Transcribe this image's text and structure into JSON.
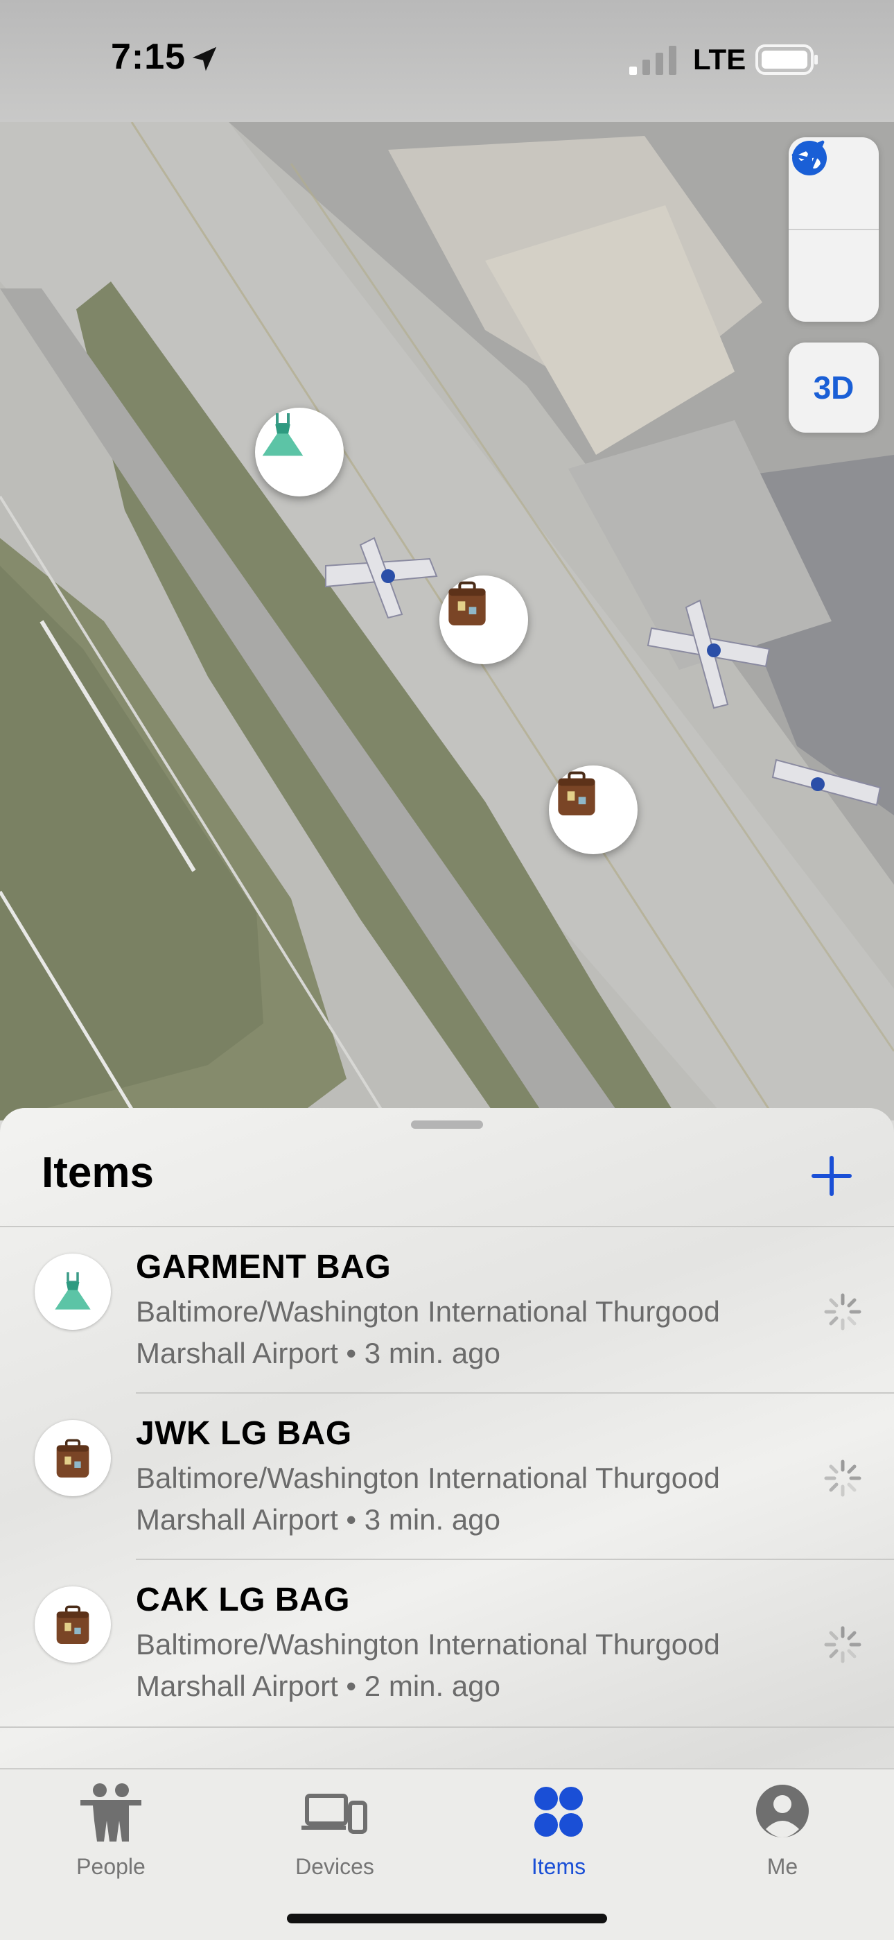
{
  "status_bar": {
    "time": "7:15",
    "network": "LTE",
    "icons": [
      "location-arrow-icon",
      "cellular-signal-icon",
      "battery-icon"
    ]
  },
  "map": {
    "controls": {
      "globe_icon": "globe-icon",
      "location_icon": "location-arrow-icon",
      "mode_3d_label": "3D"
    },
    "pins": [
      {
        "name": "GARMENT BAG",
        "emoji": "👗"
      },
      {
        "name": "JWK LG BAG",
        "emoji": "🧳"
      },
      {
        "name": "CAK LG BAG",
        "emoji": "🧳"
      }
    ]
  },
  "sheet": {
    "title": "Items",
    "add_icon": "plus-icon",
    "items": [
      {
        "name": "GARMENT BAG",
        "emoji": "👗",
        "location_line1": "Baltimore/Washington International Thurgood",
        "location_line2": "Marshall Airport • 3 min. ago"
      },
      {
        "name": "JWK LG BAG",
        "emoji": "🧳",
        "location_line1": "Baltimore/Washington International Thurgood",
        "location_line2": "Marshall Airport • 3 min. ago"
      },
      {
        "name": "CAK LG BAG",
        "emoji": "🧳",
        "location_line1": "Baltimore/Washington International Thurgood",
        "location_line2": "Marshall Airport • 2 min. ago"
      }
    ]
  },
  "tabbar": {
    "tabs": [
      {
        "label": "People",
        "icon": "people-icon",
        "active": false
      },
      {
        "label": "Devices",
        "icon": "devices-icon",
        "active": false
      },
      {
        "label": "Items",
        "icon": "items-icon",
        "active": true
      },
      {
        "label": "Me",
        "icon": "person-icon",
        "active": false
      }
    ]
  },
  "colors": {
    "accent": "#1a4fd6",
    "map_control_blue": "#1a5fd6",
    "secondary_text": "#6b6b6b"
  }
}
